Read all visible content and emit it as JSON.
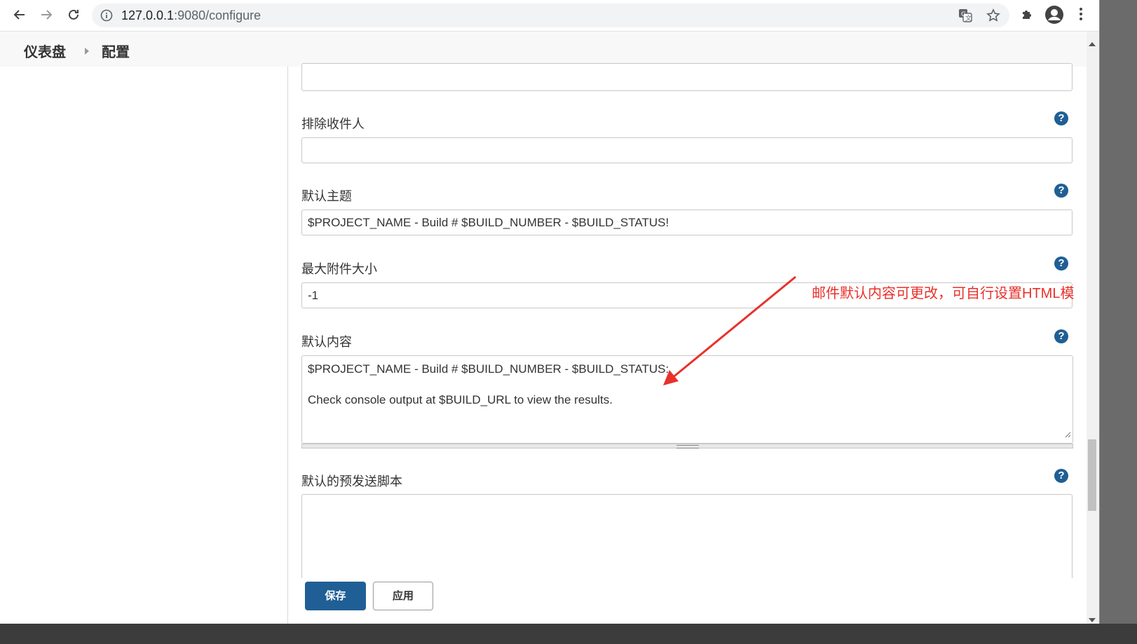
{
  "browser": {
    "url_host": "127.0.0.1",
    "url_rest": ":9080/configure",
    "icons": [
      "back-icon",
      "forward-icon",
      "reload-icon",
      "info-icon",
      "translate-icon",
      "star-icon",
      "extensions-icon",
      "profile-icon",
      "menu-icon"
    ]
  },
  "breadcrumb": {
    "items": [
      "仪表盘",
      "配置"
    ]
  },
  "form": {
    "exclude_recipients": {
      "label": "排除收件人",
      "value": ""
    },
    "default_subject": {
      "label": "默认主题",
      "value": "$PROJECT_NAME - Build # $BUILD_NUMBER - $BUILD_STATUS!"
    },
    "max_attachment_size": {
      "label": "最大附件大小",
      "value": "-1"
    },
    "default_content": {
      "label": "默认内容",
      "lines": [
        "$PROJECT_NAME - Build # $BUILD_NUMBER - $BUILD_STATUS:",
        "",
        "Check console output at $BUILD_URL to view the results."
      ]
    },
    "default_presend_script": {
      "label": "默认的预发送脚本",
      "value": ""
    },
    "help_symbol": "?"
  },
  "buttons": {
    "save": "保存",
    "apply": "应用"
  },
  "annotation": {
    "text": "邮件默认内容可更改，可自行设置HTML模",
    "color": "#e8312a"
  },
  "colors": {
    "primary": "#1f5f95",
    "annotation": "#e8312a"
  }
}
